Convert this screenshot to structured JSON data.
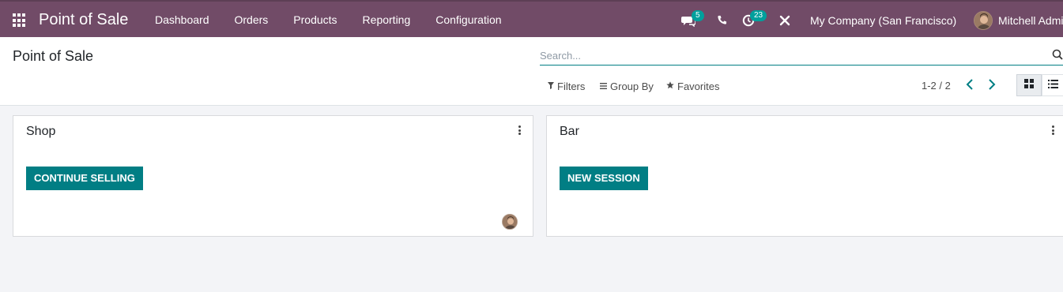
{
  "navbar": {
    "brand": "Point of Sale",
    "menu": [
      "Dashboard",
      "Orders",
      "Products",
      "Reporting",
      "Configuration"
    ],
    "messages_count": "5",
    "activities_count": "23",
    "company": "My Company (San Francisco)",
    "user": "Mitchell Admin"
  },
  "control": {
    "title": "Point of Sale",
    "search_placeholder": "Search...",
    "filters": "Filters",
    "group_by": "Group By",
    "favorites": "Favorites",
    "pager": "1-2 / 2"
  },
  "cards": [
    {
      "title": "Shop",
      "button": "CONTINUE SELLING"
    },
    {
      "title": "Bar",
      "button": "NEW SESSION"
    }
  ],
  "colors": {
    "navbar": "#714b67",
    "primary_button": "#017e84",
    "badge": "#00a09d"
  }
}
